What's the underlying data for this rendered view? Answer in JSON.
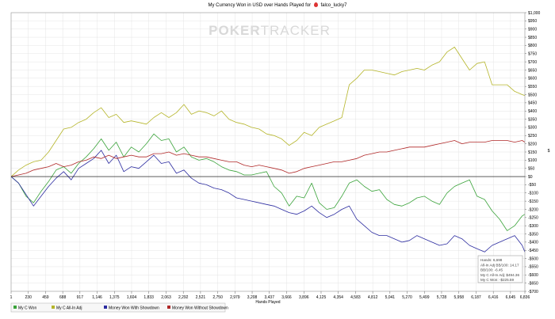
{
  "window": {
    "title_prefix": "My Currency Won in USD over Hands Played for",
    "player": "falco_lucky7"
  },
  "watermark": {
    "part1": "POKER",
    "part2": "TRACKER",
    "color": "#d8d8d8"
  },
  "colors": {
    "won": "#3aa33a",
    "allin": "#b5b52a",
    "showdown": "#2c2ca0",
    "nonshowdown": "#b02828",
    "zero_line": "#000000",
    "grid": "#e4e4e4"
  },
  "tooltip": {
    "lines": [
      "Hands: 6,698",
      "All-In Adj BB/100: 14.17",
      "BB/100: -6.45",
      "My C All-In Adj: $494.36",
      "My C Won: -$225.59"
    ]
  },
  "chart_data": {
    "type": "line",
    "title": "My Currency Won in USD over Hands Played for falco_lucky7",
    "xlabel": "Hands Played",
    "ylabel": "$",
    "xlim": [
      1,
      6836
    ],
    "ylim": [
      -700,
      1000
    ],
    "x_ticks": [
      "1",
      "230",
      "459",
      "688",
      "917",
      "1,146",
      "1,375",
      "1,604",
      "1,833",
      "2,063",
      "2,292",
      "2,521",
      "2,750",
      "2,979",
      "3,208",
      "3,437",
      "3,666",
      "3,896",
      "4,125",
      "4,354",
      "4,583",
      "4,812",
      "5,041",
      "5,270",
      "5,499",
      "5,728",
      "5,958",
      "6,187",
      "6,416",
      "6,645",
      "6,836"
    ],
    "x_tick_values": [
      1,
      230,
      459,
      688,
      917,
      1146,
      1375,
      1604,
      1833,
      2063,
      2292,
      2521,
      2750,
      2979,
      3208,
      3437,
      3666,
      3896,
      4125,
      4354,
      4583,
      4812,
      5041,
      5270,
      5499,
      5728,
      5958,
      6187,
      6416,
      6645,
      6836
    ],
    "y_ticks": [
      "$1,000",
      "$950",
      "$900",
      "$850",
      "$800",
      "$750",
      "$700",
      "$650",
      "$600",
      "$550",
      "$500",
      "$450",
      "$400",
      "$350",
      "$300",
      "$250",
      "$200",
      "$150",
      "$100",
      "$50",
      "$0",
      "-$50",
      "-$100",
      "-$150",
      "-$200",
      "-$250",
      "-$300",
      "-$350",
      "-$400",
      "-$450",
      "-$500",
      "-$550",
      "-$600",
      "-$650",
      "-$700"
    ],
    "y_tick_values": [
      1000,
      950,
      900,
      850,
      800,
      750,
      700,
      650,
      600,
      550,
      500,
      450,
      400,
      350,
      300,
      250,
      200,
      150,
      100,
      50,
      0,
      -50,
      -100,
      -150,
      -200,
      -250,
      -300,
      -350,
      -400,
      -450,
      -500,
      -550,
      -600,
      -650,
      -700
    ],
    "legend_position": "bottom-left",
    "series": [
      {
        "name": "My C Won",
        "color": "#3aa33a",
        "x": [
          1,
          100,
          200,
          300,
          400,
          500,
          600,
          700,
          800,
          900,
          1000,
          1100,
          1200,
          1300,
          1400,
          1500,
          1600,
          1700,
          1800,
          1900,
          2000,
          2100,
          2200,
          2300,
          2400,
          2500,
          2600,
          2700,
          2800,
          2900,
          3000,
          3100,
          3200,
          3300,
          3400,
          3500,
          3600,
          3700,
          3800,
          3900,
          4000,
          4100,
          4200,
          4300,
          4400,
          4500,
          4600,
          4700,
          4800,
          4900,
          5000,
          5100,
          5200,
          5300,
          5400,
          5500,
          5600,
          5700,
          5800,
          5900,
          6000,
          6100,
          6200,
          6300,
          6400,
          6500,
          6600,
          6700,
          6800,
          6836
        ],
        "y": [
          0,
          -40,
          -120,
          -160,
          -90,
          -30,
          40,
          60,
          20,
          80,
          120,
          170,
          230,
          160,
          210,
          120,
          180,
          150,
          200,
          260,
          220,
          230,
          150,
          180,
          120,
          100,
          110,
          90,
          60,
          40,
          30,
          10,
          10,
          20,
          30,
          -60,
          -100,
          -180,
          -120,
          -130,
          -40,
          -160,
          -200,
          -190,
          -120,
          -40,
          -20,
          -60,
          -90,
          -80,
          -140,
          -170,
          -180,
          -160,
          -130,
          -120,
          -150,
          -170,
          -100,
          -60,
          -40,
          -20,
          -120,
          -140,
          -210,
          -260,
          -330,
          -300,
          -240,
          -230
        ]
      },
      {
        "name": "My C All-In Adj",
        "color": "#b5b52a",
        "x": [
          1,
          100,
          200,
          300,
          400,
          500,
          600,
          700,
          800,
          900,
          1000,
          1100,
          1200,
          1300,
          1400,
          1500,
          1600,
          1700,
          1800,
          1900,
          2000,
          2100,
          2200,
          2300,
          2400,
          2500,
          2600,
          2700,
          2800,
          2900,
          3000,
          3100,
          3200,
          3300,
          3400,
          3500,
          3600,
          3700,
          3800,
          3900,
          4000,
          4100,
          4200,
          4300,
          4400,
          4500,
          4600,
          4700,
          4800,
          4900,
          5000,
          5100,
          5200,
          5300,
          5400,
          5500,
          5600,
          5700,
          5800,
          5900,
          6000,
          6100,
          6200,
          6300,
          6400,
          6500,
          6600,
          6700,
          6800,
          6836
        ],
        "y": [
          0,
          40,
          70,
          90,
          100,
          150,
          220,
          290,
          300,
          330,
          350,
          390,
          420,
          360,
          380,
          330,
          340,
          330,
          320,
          360,
          390,
          360,
          390,
          440,
          380,
          400,
          390,
          370,
          400,
          350,
          330,
          320,
          300,
          290,
          260,
          250,
          230,
          190,
          220,
          270,
          250,
          300,
          320,
          340,
          360,
          560,
          600,
          650,
          650,
          640,
          630,
          620,
          640,
          650,
          660,
          650,
          680,
          700,
          760,
          790,
          720,
          650,
          690,
          700,
          560,
          560,
          560,
          520,
          500,
          494
        ]
      },
      {
        "name": "Money Won With Showdown",
        "color": "#2c2ca0",
        "x": [
          1,
          100,
          200,
          300,
          400,
          500,
          600,
          700,
          800,
          900,
          1000,
          1100,
          1200,
          1300,
          1400,
          1500,
          1600,
          1700,
          1800,
          1900,
          2000,
          2100,
          2200,
          2300,
          2400,
          2500,
          2600,
          2700,
          2800,
          2900,
          3000,
          3100,
          3200,
          3300,
          3400,
          3500,
          3600,
          3700,
          3800,
          3900,
          4000,
          4100,
          4200,
          4300,
          4400,
          4500,
          4600,
          4700,
          4800,
          4900,
          5000,
          5100,
          5200,
          5300,
          5400,
          5500,
          5600,
          5700,
          5800,
          5900,
          6000,
          6100,
          6200,
          6300,
          6400,
          6500,
          6600,
          6700,
          6800,
          6836
        ],
        "y": [
          0,
          -40,
          -110,
          -180,
          -120,
          -60,
          -10,
          30,
          -20,
          50,
          80,
          110,
          160,
          80,
          130,
          30,
          60,
          50,
          90,
          130,
          80,
          90,
          20,
          40,
          -10,
          -40,
          -50,
          -70,
          -80,
          -100,
          -130,
          -140,
          -150,
          -160,
          -170,
          -180,
          -200,
          -220,
          -230,
          -210,
          -180,
          -220,
          -250,
          -230,
          -200,
          -180,
          -260,
          -300,
          -340,
          -360,
          -360,
          -380,
          -400,
          -390,
          -360,
          -380,
          -400,
          -420,
          -410,
          -360,
          -380,
          -420,
          -440,
          -460,
          -420,
          -400,
          -380,
          -360,
          -420,
          -460
        ]
      },
      {
        "name": "Money Won Without Showdown",
        "color": "#b02828",
        "x": [
          1,
          100,
          200,
          300,
          400,
          500,
          600,
          700,
          800,
          900,
          1000,
          1100,
          1200,
          1300,
          1400,
          1500,
          1600,
          1700,
          1800,
          1900,
          2000,
          2100,
          2200,
          2300,
          2400,
          2500,
          2600,
          2700,
          2800,
          2900,
          3000,
          3100,
          3200,
          3300,
          3400,
          3500,
          3600,
          3700,
          3800,
          3900,
          4000,
          4100,
          4200,
          4300,
          4400,
          4500,
          4600,
          4700,
          4800,
          4900,
          5000,
          5100,
          5200,
          5300,
          5400,
          5500,
          5600,
          5700,
          5800,
          5900,
          6000,
          6100,
          6200,
          6300,
          6400,
          6500,
          6600,
          6700,
          6800,
          6836
        ],
        "y": [
          0,
          10,
          20,
          40,
          50,
          60,
          80,
          60,
          70,
          90,
          100,
          120,
          110,
          130,
          110,
          120,
          130,
          120,
          120,
          140,
          140,
          150,
          130,
          140,
          130,
          120,
          120,
          110,
          100,
          90,
          90,
          70,
          60,
          70,
          60,
          50,
          40,
          20,
          30,
          50,
          60,
          70,
          80,
          90,
          90,
          100,
          110,
          130,
          140,
          150,
          150,
          160,
          170,
          180,
          180,
          180,
          190,
          200,
          210,
          220,
          200,
          210,
          210,
          210,
          220,
          220,
          220,
          210,
          220,
          210
        ]
      }
    ]
  }
}
